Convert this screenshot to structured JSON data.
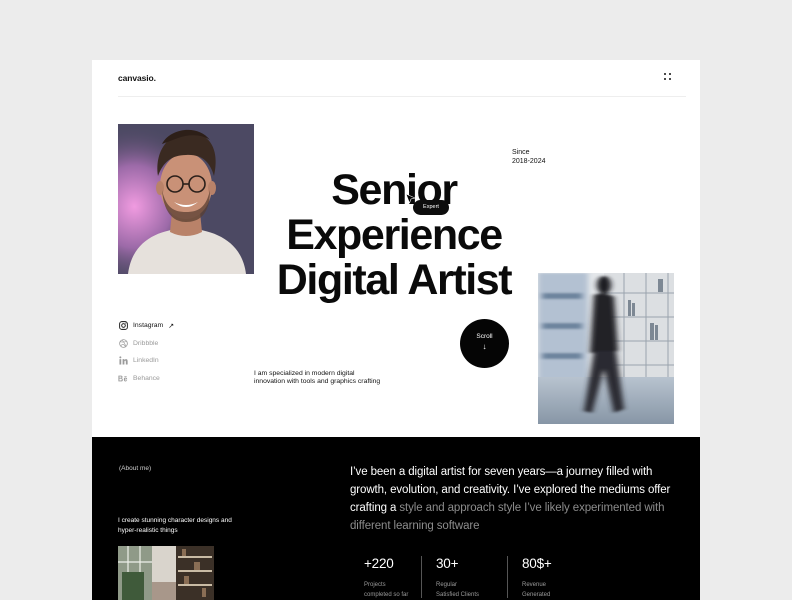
{
  "header": {
    "logo": "canvasio.",
    "menu_icon": "grid-dots-icon"
  },
  "hero": {
    "since_label": "Since",
    "since_years": "2018-2024",
    "headline": [
      "Senior",
      "Experience",
      "Digital Artist"
    ],
    "badge": "Expert",
    "intro": "I am specialized in modern digital innovation with tools and graphics crafting",
    "scroll_label": "Scroll",
    "scroll_arrow": "↓"
  },
  "socials": [
    {
      "label": "Instagram",
      "icon": "instagram-icon",
      "active": true,
      "arrow": "↗"
    },
    {
      "label": "Dribbble",
      "icon": "dribbble-icon",
      "active": false
    },
    {
      "label": "LinkedIn",
      "icon": "linkedin-icon",
      "active": false
    },
    {
      "label": "Behance",
      "icon": "behance-icon",
      "active": false
    }
  ],
  "about": {
    "tag": "(About me)",
    "create_text": "I create stunning character designs and hyper-realistic things",
    "bio_highlight": "I’ve been a digital artist for seven years—a journey filled with growth, evolution, and creativity. I’ve explored the mediums offer crafting a",
    "bio_muted": " style and approach style I’ve likely experimented with different learning software"
  },
  "stats": [
    {
      "value": "+220",
      "label1": "Projects",
      "label2": "completed so far"
    },
    {
      "value": "30+",
      "label1": "Regular",
      "label2": "Satisfied Clients"
    },
    {
      "value": "80$+",
      "label1": "Revenue",
      "label2": "Generated"
    }
  ],
  "colors": {
    "accent": "#000000",
    "background": "#ececec",
    "muted": "#8c8c8c"
  }
}
